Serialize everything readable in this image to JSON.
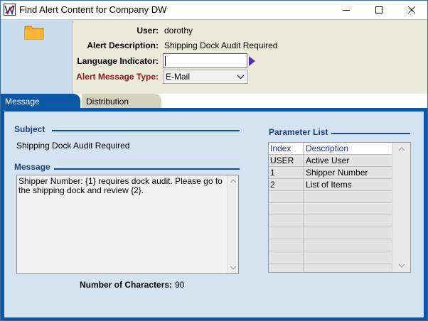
{
  "window": {
    "title": "Find Alert Content for Company DW",
    "minimize_icon": "minimize-icon",
    "maximize_icon": "maximize-icon",
    "close_icon": "close-icon"
  },
  "header": {
    "user_label": "User:",
    "user_value": "dorothy",
    "alert_description_label": "Alert Description:",
    "alert_description_value": "Shipping Dock Audit Required",
    "language_indicator_label": "Language Indicator:",
    "language_indicator_value": "",
    "alert_message_type_label": "Alert Message Type:",
    "alert_message_type_value": "E-Mail"
  },
  "tabs": [
    {
      "label": "Message",
      "active": true
    },
    {
      "label": "Distribution",
      "active": false
    }
  ],
  "message_tab": {
    "subject_title": "Subject",
    "subject_value": "Shipping Dock Audit Required",
    "message_title": "Message",
    "message_value": "Shipper Number:  {1} requires dock audit.  Please go to the shipping dock and review  {2}.",
    "num_chars_label": "Number of Characters:",
    "num_chars_value": "90"
  },
  "parameter_list": {
    "title": "Parameter List",
    "columns": [
      "Index",
      "Description"
    ],
    "rows": [
      [
        "USER",
        "Active User"
      ],
      [
        "1",
        "Shipper Number"
      ],
      [
        "2",
        "List of Items"
      ],
      [
        "",
        ""
      ],
      [
        "",
        ""
      ],
      [
        "",
        ""
      ],
      [
        "",
        ""
      ],
      [
        "",
        ""
      ],
      [
        "",
        ""
      ],
      [
        "",
        ""
      ]
    ]
  },
  "colors": {
    "accent_blue": "#0a57a6",
    "label_red": "#8b1a1a",
    "header_bg": "#ecebdb",
    "content_bg": "#d4e3f2"
  }
}
